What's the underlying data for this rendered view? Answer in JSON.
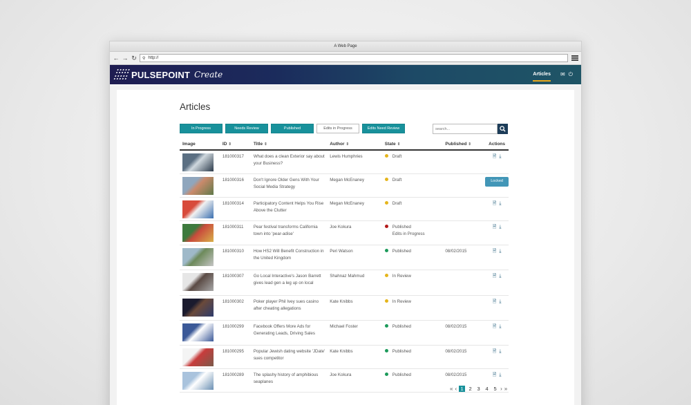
{
  "browser": {
    "title": "A Web Page",
    "url": "http://"
  },
  "app": {
    "logo_text": "PULSEPOINT",
    "logo_sub": "Create",
    "nav_label": "Articles"
  },
  "page": {
    "title": "Articles"
  },
  "filters": [
    "In Progress",
    "Needs Review",
    "Published",
    "Edits in Progress",
    "Edits Need Review"
  ],
  "search": {
    "placeholder": "search..."
  },
  "table": {
    "headers": {
      "image": "Image",
      "id": "ID",
      "title": "Title",
      "author": "Author",
      "state": "State",
      "published": "Published",
      "actions": "Actions"
    },
    "rows": [
      {
        "id": "181000317",
        "title": "What does a clean Exterior say about your Business?",
        "author": "Lewis Humphries",
        "state": "Draft",
        "state_color": "#e5b51c",
        "state_extra": "",
        "published": "",
        "action": "icons",
        "thumb_colors": [
          "#5b6f82",
          "#cfd8de",
          "#2b3a4a"
        ]
      },
      {
        "id": "181000316",
        "title": "Don't Ignore Older Gens With Your Social Media Strategy",
        "author": "Megan McEnaney",
        "state": "Draft",
        "state_color": "#e5b51c",
        "state_extra": "",
        "published": "",
        "action": "locked",
        "locked_label": "Locked",
        "thumb_colors": [
          "#8fa6bd",
          "#c98a6b",
          "#5f7a4a"
        ]
      },
      {
        "id": "181000314",
        "title": "Participatory Content Helps You Rise Above the Clutter",
        "author": "Megan McEnaney",
        "state": "Draft",
        "state_color": "#e5b51c",
        "state_extra": "",
        "published": "",
        "action": "icons",
        "thumb_colors": [
          "#d84b3b",
          "#f1f1f1",
          "#3a6fb0"
        ]
      },
      {
        "id": "181000311",
        "title": "Pear festival transforms California town into 'pear-adise'",
        "author": "Joe Kokura",
        "state": "Published",
        "state_color": "#b21a1a",
        "state_extra": "Edits in Progress",
        "published": "",
        "action": "icons",
        "thumb_colors": [
          "#3d7a3d",
          "#c94b3c",
          "#d8b04a"
        ]
      },
      {
        "id": "181000310",
        "title": "How HS2 Will Benefit Construction in the United Kingdom",
        "author": "Peri Watson",
        "state": "Published",
        "state_color": "#1c9a5a",
        "state_extra": "",
        "published": "08/02/2015",
        "action": "icons",
        "thumb_colors": [
          "#9fb9c9",
          "#6d8a5a",
          "#c5c5c5"
        ]
      },
      {
        "id": "181000307",
        "title": "Go Local Interactive's Jason Barrett gives lead gen a leg up on local",
        "author": "Shahnaz Mahmud",
        "state": "In Review",
        "state_color": "#e5b51c",
        "state_extra": "",
        "published": "",
        "action": "icons",
        "thumb_colors": [
          "#e6e6e6",
          "#5a4a44",
          "#a8a8a8"
        ]
      },
      {
        "id": "181000302",
        "title": "Poker player Phil Ivey sues casino after cheating allegations",
        "author": "Kate Knibbs",
        "state": "In Review",
        "state_color": "#e5b51c",
        "state_extra": "",
        "published": "",
        "action": "icons",
        "thumb_colors": [
          "#1b1b2e",
          "#6b4a3a",
          "#2d3b6b"
        ]
      },
      {
        "id": "181000299",
        "title": "Facebook Offers More Ads for Generating Leads, Driving Sales",
        "author": "Michael Foster",
        "state": "Published",
        "state_color": "#1c9a5a",
        "state_extra": "",
        "published": "08/02/2015",
        "action": "icons",
        "thumb_colors": [
          "#3b5998",
          "#ffffff",
          "#3b5998"
        ]
      },
      {
        "id": "181000295",
        "title": "Popular Jewish dating website 'JDate' sues competitor",
        "author": "Kate Knibbs",
        "state": "Published",
        "state_color": "#1c9a5a",
        "state_extra": "",
        "published": "08/02/2015",
        "action": "icons",
        "thumb_colors": [
          "#f4f4f4",
          "#c83c3c",
          "#7a5a4a"
        ]
      },
      {
        "id": "181000289",
        "title": "The splashy history of amphibious seaplanes",
        "author": "Joe Kokura",
        "state": "Published",
        "state_color": "#1c9a5a",
        "state_extra": "",
        "published": "08/02/2015",
        "action": "icons",
        "thumb_colors": [
          "#a9c3dd",
          "#ffffff",
          "#6a8fb3"
        ]
      }
    ]
  },
  "pagination": {
    "first": "«",
    "prev": "‹",
    "pages": [
      "1",
      "2",
      "3",
      "4",
      "5"
    ],
    "current": "1",
    "next": "›",
    "last": "»"
  },
  "colors": {
    "accent": "#18919b",
    "header_dark": "#1f1d52",
    "nav_underline": "#e9a91c"
  }
}
